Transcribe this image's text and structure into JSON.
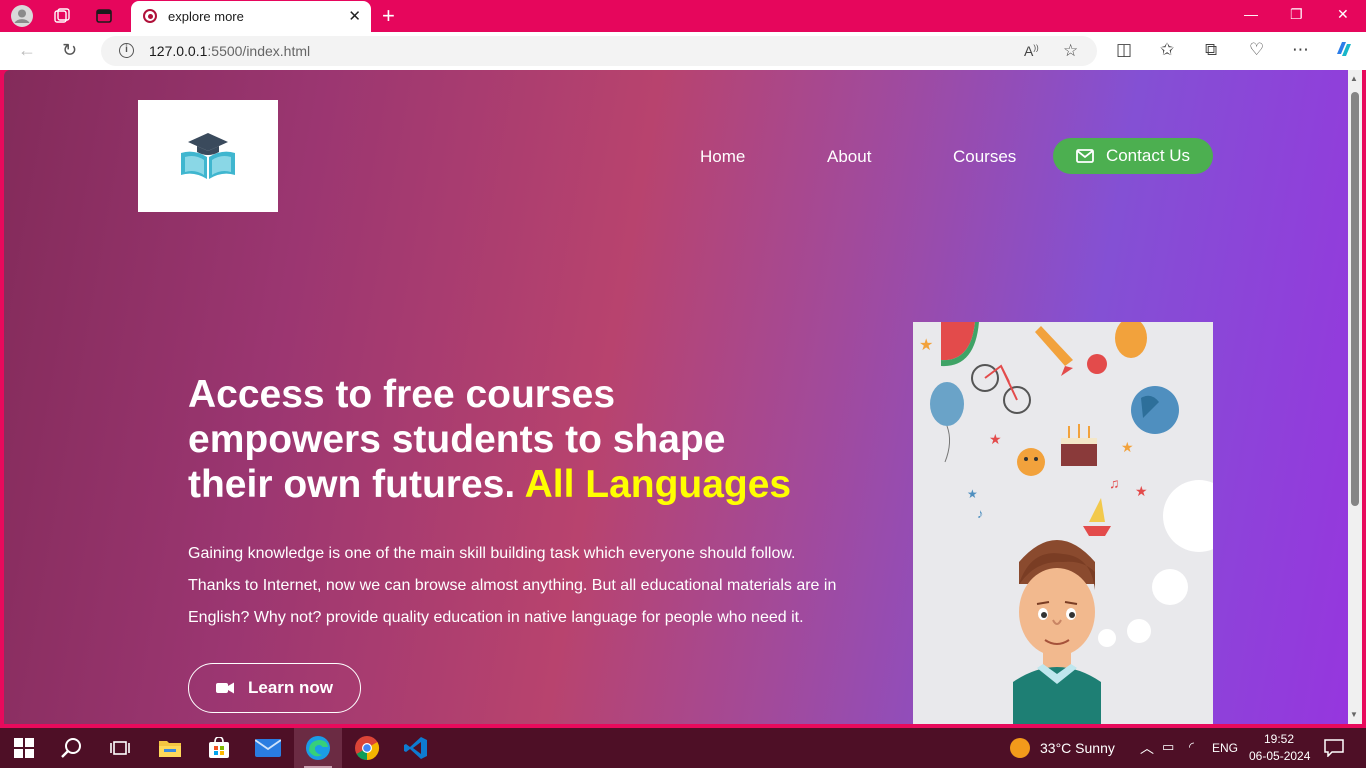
{
  "browser": {
    "tab_title": "explore more",
    "url_host": "127.0.0.1",
    "url_rest": ":5500/index.html"
  },
  "nav": {
    "items": [
      {
        "label": "Home"
      },
      {
        "label": "About"
      },
      {
        "label": "Courses"
      }
    ],
    "contact_label": "Contact Us"
  },
  "hero": {
    "title_line1": "Access to free courses",
    "title_line2": "empowers students to shape",
    "title_line3": "their own futures.",
    "title_highlight": "All Languages",
    "paragraph": "Gaining knowledge is one of the main skill building task which everyone should follow. Thanks to Internet, now we can browse almost anything. But all educational materials are in English? Why not? provide quality education in native language for people who need it.",
    "button_label": "Learn now"
  },
  "taskbar": {
    "weather": "33°C  Sunny",
    "language": "ENG",
    "time": "19:52",
    "date": "06-05-2024"
  },
  "colors": {
    "highlight": "#ffff00",
    "contact_button": "#4caf50",
    "tab_bar": "#e6065c"
  },
  "icons": {
    "logo": "graduation-book-icon",
    "contact": "envelope-icon",
    "learn": "video-camera-icon"
  }
}
